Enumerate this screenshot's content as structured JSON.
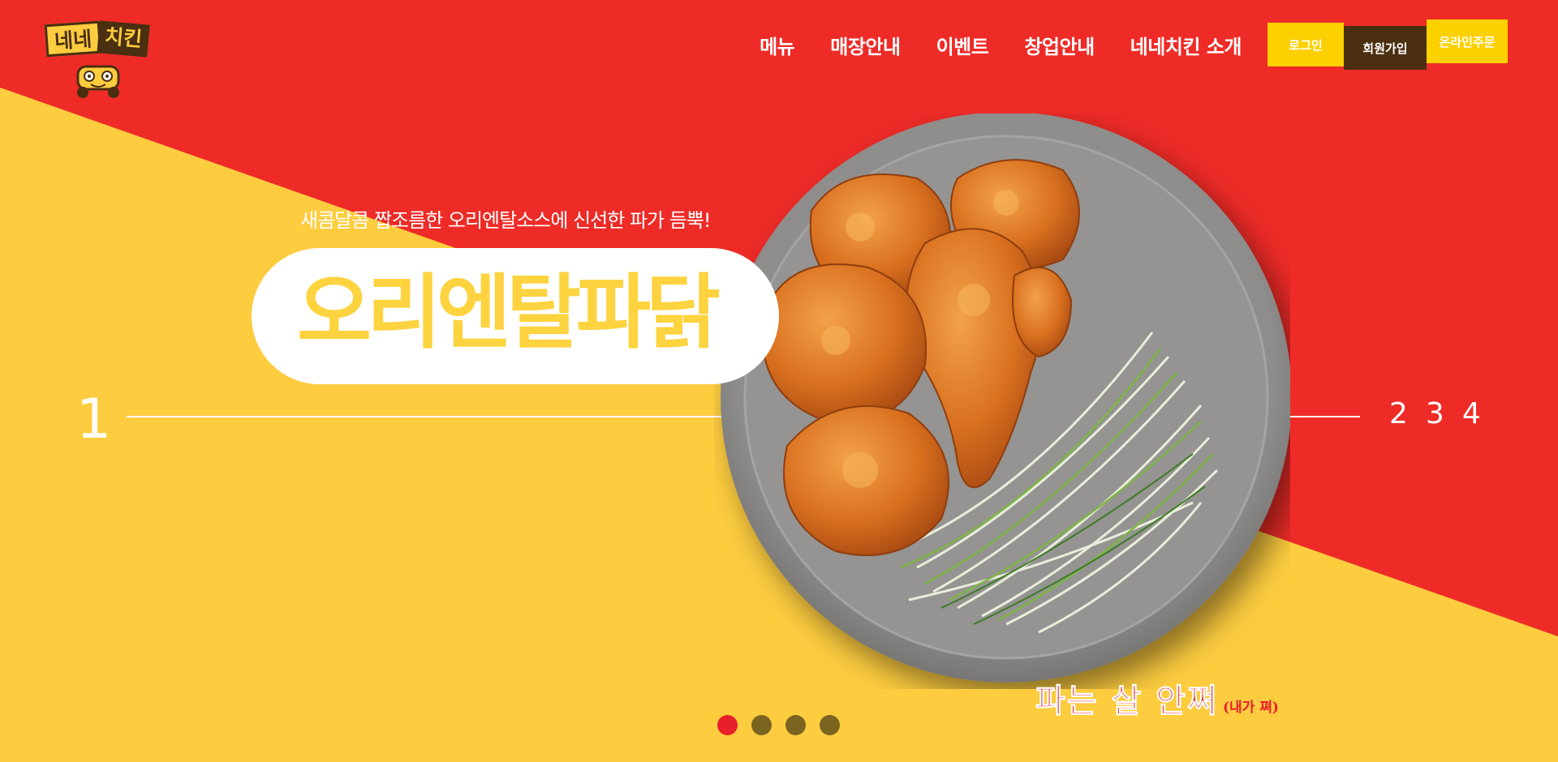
{
  "brand": {
    "logo_word1": "네네",
    "logo_word2": "치킨"
  },
  "nav": {
    "items": [
      "메뉴",
      "매장안내",
      "이벤트",
      "창업안내",
      "네네치킨 소개"
    ]
  },
  "auth": {
    "login": "로그인",
    "join": "회원가입",
    "order": "온라인주문"
  },
  "hero": {
    "slogan": "새콤달콤 짭조름한 오리엔탈소스에 신선한 파가 듬뿍!",
    "title": "오리엔탈파닭",
    "catchphrase": "파는 살 안쪄",
    "catchphrase_sub": "(내가 쪄)",
    "image": "fried-chicken-with-green-onion-plate"
  },
  "slider": {
    "current": "1",
    "others": [
      "2",
      "3",
      "4"
    ],
    "dot_count": 4,
    "active_dot": 0
  },
  "colors": {
    "red": "#ee2b27",
    "yellow": "#fdcc3f",
    "brown": "#4a2f10",
    "dot_active": "#e8202a",
    "dot_inactive": "#7a6420"
  }
}
